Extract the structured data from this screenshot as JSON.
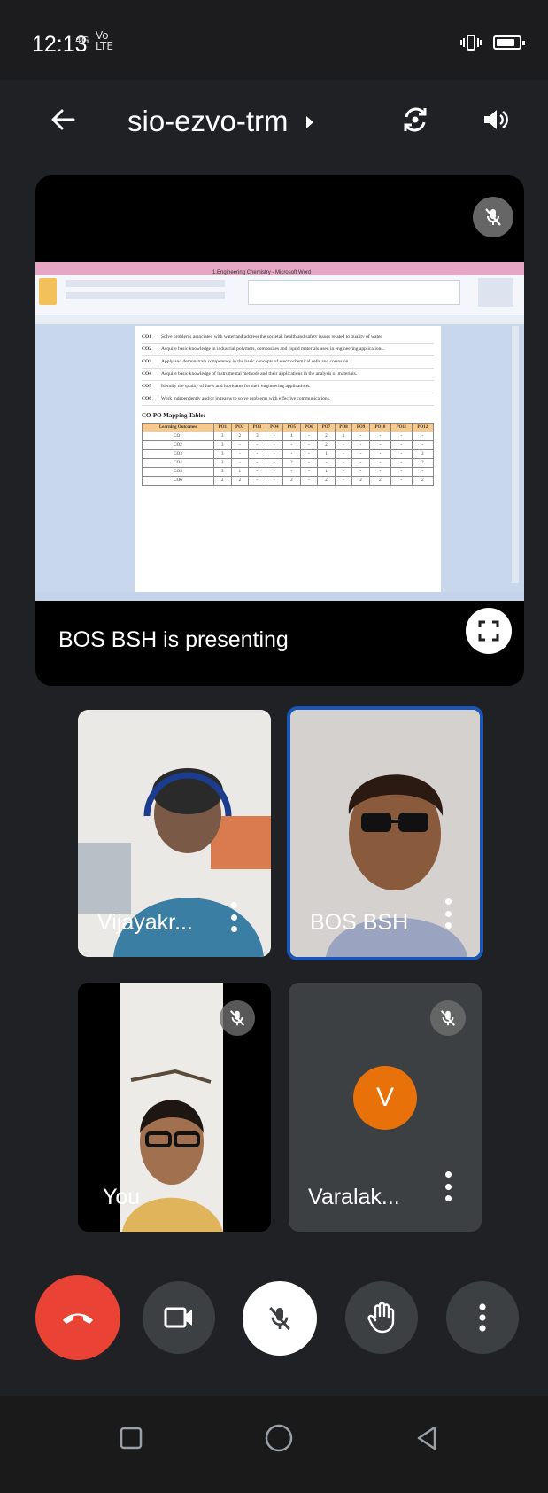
{
  "status_bar": {
    "time": "12:13",
    "network_line1": "Vo",
    "network_line2": "LTE",
    "signal_label": "4G"
  },
  "header": {
    "meeting_code": "sio-ezvo-trm",
    "back_icon": "arrow-back-icon",
    "camera_switch_icon": "camera-switch-icon",
    "audio_icon": "speaker-icon"
  },
  "presentation": {
    "label": "BOS BSH is presenting",
    "window_title": "1.Engineering Chemistry - Microsoft Word",
    "course_outcomes": [
      {
        "code": "CO1",
        "text": "Solve problems associated with water and address the societal, health and safety issues related to quality of water."
      },
      {
        "code": "CO2",
        "text": "Acquire basic knowledge in industrial polymers, composites and liquid materials used in engineering applications."
      },
      {
        "code": "CO3",
        "text": "Apply and demonstrate competency in the basic concepts of electrochemical cells and corrosion."
      },
      {
        "code": "CO4",
        "text": "Acquire basic knowledge of instrumental methods and their applications in the analysis of materials."
      },
      {
        "code": "CO5",
        "text": "Identify the quality of fuels and lubricants for their engineering applications."
      },
      {
        "code": "CO6",
        "text": "Work independently and/or in teams to solve problems with effective communications."
      }
    ],
    "mapping_title": "CO-PO Mapping Table:",
    "table_header": [
      "Learning Outcomes",
      "PO1",
      "PO2",
      "PO3",
      "PO4",
      "PO5",
      "PO6",
      "PO7",
      "PO8",
      "PO9",
      "PO10",
      "PO11",
      "PO12"
    ],
    "table_rows": [
      [
        "CO1",
        "3",
        "2",
        "3",
        "-",
        "1",
        "-",
        "2",
        "1",
        "-",
        "-",
        "-",
        "-"
      ],
      [
        "CO2",
        "3",
        "-",
        "-",
        "-",
        "-",
        "-",
        "2",
        "-",
        "-",
        "-",
        "-",
        "-"
      ],
      [
        "CO3",
        "3",
        "-",
        "-",
        "-",
        "-",
        "-",
        "1",
        "-",
        "-",
        "-",
        "-",
        "2"
      ],
      [
        "CO4",
        "3",
        "-",
        "-",
        "-",
        "2",
        "-",
        "-",
        "-",
        "-",
        "-",
        "-",
        "2"
      ],
      [
        "CO5",
        "3",
        "1",
        "-",
        "-",
        "-",
        "-",
        "1",
        "-",
        "-",
        "-",
        "-",
        "-"
      ],
      [
        "CO6",
        "2",
        "2",
        "-",
        "-",
        "2",
        "-",
        "2",
        "-",
        "2",
        "2",
        "-",
        "2"
      ]
    ]
  },
  "participants": [
    {
      "name": "Vijayakr...",
      "muted": false
    },
    {
      "name": "BOS BSH",
      "muted": false,
      "active_speaker": true
    },
    {
      "name": "You",
      "muted": true
    },
    {
      "name": "Varalak...",
      "muted": true,
      "avatar_letter": "V",
      "avatar_color": "#e8710a"
    }
  ],
  "controls": {
    "end_call_color": "#ea4335",
    "end_call_icon": "end-call-icon",
    "camera_icon": "video-camera-icon",
    "mic_icon": "mic-off-icon",
    "hand_icon": "raise-hand-icon",
    "more_icon": "more-vertical-icon"
  },
  "nav": {
    "recents_icon": "square-icon",
    "home_icon": "circle-icon",
    "back_icon": "triangle-back-icon"
  }
}
